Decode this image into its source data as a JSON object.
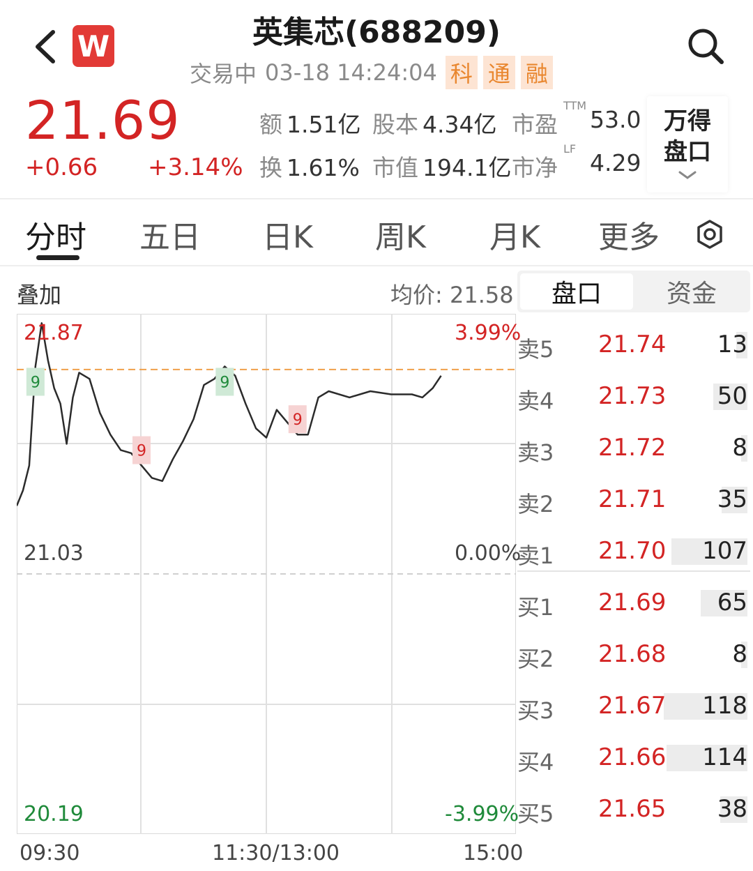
{
  "header": {
    "title": "英集芯(688209)",
    "status": "交易中",
    "datetime": "03-18 14:24:04",
    "tags": [
      "科",
      "通",
      "融"
    ],
    "logo_letter": "W"
  },
  "quote": {
    "price": "21.69",
    "change": "+0.66",
    "change_pct": "+3.14%",
    "stats": {
      "amount_label": "额",
      "amount": "1.51亿",
      "share_capital_label": "股本",
      "share_capital": "4.34亿",
      "pe_label": "市盈",
      "pe_sup": "TTM",
      "pe": "53.0",
      "turnover_label": "换",
      "turnover": "1.61%",
      "market_cap_label": "市值",
      "market_cap": "194.1亿",
      "pb_label": "市净",
      "pb_sup": "LF",
      "pb": "4.29"
    },
    "wind_box": [
      "万得",
      "盘口"
    ]
  },
  "tabs": [
    "分时",
    "五日",
    "日K",
    "周K",
    "月K",
    "更多"
  ],
  "chart_header": {
    "overlay": "叠加",
    "avg_label": "均价:",
    "avg_value": "21.58",
    "segments": [
      "盘口",
      "资金"
    ]
  },
  "axis_labels": {
    "left_top": "21.87",
    "right_top": "3.99%",
    "left_mid": "21.03",
    "right_mid": "0.00%",
    "left_bot": "20.19",
    "right_bot": "-3.99%",
    "times": [
      "09:30",
      "11:30/13:00",
      "15:00"
    ]
  },
  "chart_data": {
    "type": "line",
    "ylim": [
      20.19,
      21.87
    ],
    "reference_price": 21.03,
    "current_price": 21.69,
    "x_range": [
      "09:30",
      "15:00"
    ],
    "markers": [
      {
        "label": "9",
        "type": "high",
        "time": "09:39"
      },
      {
        "label": "9",
        "type": "low",
        "time": "10:30"
      },
      {
        "label": "9",
        "type": "high",
        "time": "11:10"
      },
      {
        "label": "9",
        "type": "low",
        "time": "13:15"
      }
    ],
    "x": [
      "09:30",
      "09:33",
      "09:36",
      "09:39",
      "09:42",
      "09:45",
      "09:48",
      "09:51",
      "09:54",
      "09:57",
      "10:00",
      "10:05",
      "10:10",
      "10:15",
      "10:20",
      "10:25",
      "10:30",
      "10:35",
      "10:40",
      "10:45",
      "10:50",
      "10:55",
      "11:00",
      "11:05",
      "11:10",
      "11:15",
      "11:20",
      "11:25",
      "11:30",
      "13:05",
      "13:10",
      "13:15",
      "13:20",
      "13:25",
      "13:30",
      "13:40",
      "13:50",
      "14:00",
      "14:10",
      "14:15",
      "14:20",
      "14:24"
    ],
    "y": [
      21.25,
      21.3,
      21.38,
      21.7,
      21.84,
      21.72,
      21.63,
      21.58,
      21.45,
      21.6,
      21.68,
      21.66,
      21.55,
      21.48,
      21.43,
      21.42,
      21.38,
      21.34,
      21.33,
      21.4,
      21.46,
      21.53,
      21.64,
      21.66,
      21.7,
      21.67,
      21.58,
      21.5,
      21.47,
      21.56,
      21.52,
      21.48,
      21.48,
      21.6,
      21.62,
      21.6,
      21.62,
      21.61,
      21.61,
      21.6,
      21.63,
      21.67
    ]
  },
  "order_book": {
    "asks": [
      {
        "label": "卖5",
        "price": "21.74",
        "vol": "13",
        "bar": 0.13
      },
      {
        "label": "卖4",
        "price": "21.73",
        "vol": "50",
        "bar": 0.4
      },
      {
        "label": "卖3",
        "price": "21.72",
        "vol": "8",
        "bar": 0.07
      },
      {
        "label": "卖2",
        "price": "21.71",
        "vol": "35",
        "bar": 0.3
      },
      {
        "label": "卖1",
        "price": "21.70",
        "vol": "107",
        "bar": 0.89
      }
    ],
    "bids": [
      {
        "label": "买1",
        "price": "21.69",
        "vol": "65",
        "bar": 0.55
      },
      {
        "label": "买2",
        "price": "21.68",
        "vol": "8",
        "bar": 0.07
      },
      {
        "label": "买3",
        "price": "21.67",
        "vol": "118",
        "bar": 0.98
      },
      {
        "label": "买4",
        "price": "21.66",
        "vol": "114",
        "bar": 0.95
      },
      {
        "label": "买5",
        "price": "21.65",
        "vol": "38",
        "bar": 0.32
      }
    ]
  },
  "colors": {
    "up": "#d32424",
    "down": "#1f8a3a",
    "avg_line": "#f0a04b",
    "line": "#2b2b2b"
  }
}
